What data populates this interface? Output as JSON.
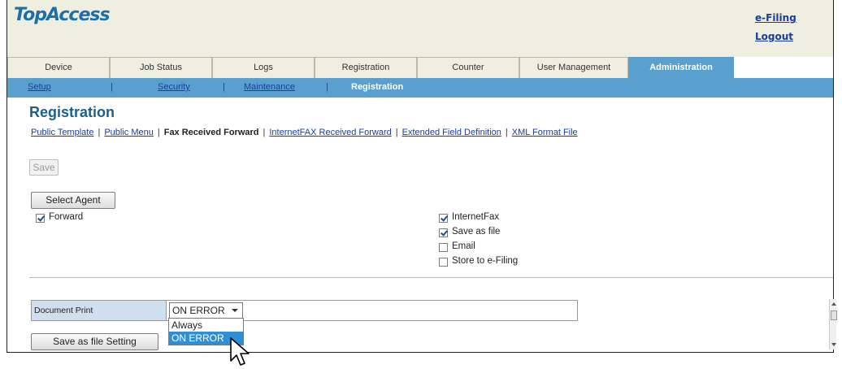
{
  "header": {
    "logo": "TopAccess",
    "links": {
      "efiling": "e-Filing",
      "logout": "Logout"
    }
  },
  "tabs": [
    {
      "label": "Device"
    },
    {
      "label": "Job Status"
    },
    {
      "label": "Logs"
    },
    {
      "label": "Registration"
    },
    {
      "label": "Counter"
    },
    {
      "label": "User Management"
    },
    {
      "label": "Administration",
      "active": true
    }
  ],
  "subnav": {
    "items": [
      "Setup",
      "Security",
      "Maintenance",
      "Registration"
    ],
    "separator": "|",
    "active": "Registration"
  },
  "page": {
    "title": "Registration",
    "breadcrumbs": [
      "Public Template",
      "Public Menu",
      "Fax Received Forward",
      "InternetFAX Received Forward",
      "Extended Field Definition",
      "XML Format File"
    ],
    "current_breadcrumb": "Fax Received Forward"
  },
  "buttons": {
    "save": "Save",
    "select_agent": "Select Agent",
    "save_as_file_setting": "Save as file Setting"
  },
  "checkboxes": {
    "forward": {
      "label": "Forward",
      "checked": true
    },
    "internetfax": {
      "label": "InternetFax",
      "checked": true
    },
    "save_as_file": {
      "label": "Save as file",
      "checked": true
    },
    "email": {
      "label": "Email",
      "checked": false
    },
    "store_efiling": {
      "label": "Store to e-Filing",
      "checked": false
    }
  },
  "document_print": {
    "label": "Document Print",
    "selected": "ON ERROR",
    "options": [
      "Always",
      "ON ERROR"
    ],
    "highlighted": "ON ERROR"
  },
  "colors": {
    "accent": "#5aa0cf",
    "header_bg": "#efefe1",
    "title": "#1c5f8c",
    "link": "#1a3d9a",
    "selected_option": "#2f8fd2"
  },
  "icons": [
    "mouse-pointer-icon",
    "dropdown-caret-icon",
    "checkmark-icon"
  ]
}
